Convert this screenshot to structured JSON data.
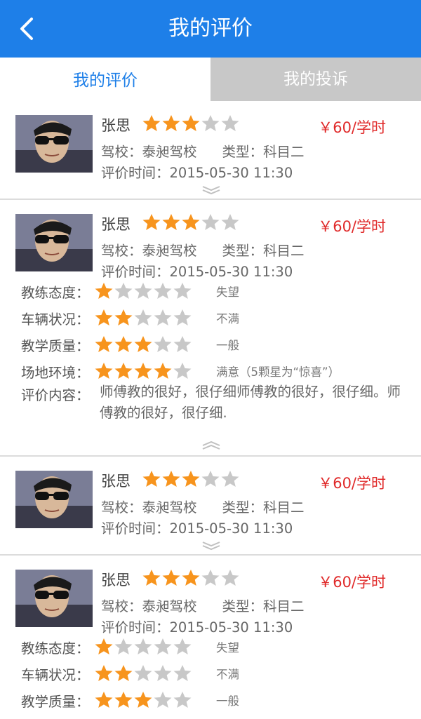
{
  "header": {
    "title": "我的评价",
    "back_icon": "chevron-left-icon",
    "bg_color": "#1e7fe8"
  },
  "tabs": [
    {
      "label": "我的评价",
      "active": true
    },
    {
      "label": "我的投诉",
      "active": false
    }
  ],
  "colors": {
    "star_on": "#f7941d",
    "star_off": "#c8c8c8",
    "price": "#e02a2a"
  },
  "reviews": [
    {
      "name": "张思",
      "stars": 3,
      "price": "￥60/学时",
      "school_label": "驾校：",
      "school": "泰昶驾校",
      "type_label": "类型：",
      "type": "科目二",
      "time_label": "评价时间：",
      "time": "2015-05-30  11:30",
      "expanded": false,
      "toggle_icon": "chevron-down-double-icon"
    },
    {
      "name": "张思",
      "stars": 3,
      "price": "￥60/学时",
      "school_label": "驾校：",
      "school": "泰昶驾校",
      "type_label": "类型：",
      "type": "科目二",
      "time_label": "评价时间：",
      "time": "2015-05-30  11:30",
      "expanded": true,
      "toggle_icon": "chevron-up-double-icon",
      "ratings": [
        {
          "label": "教练态度：",
          "stars": 1,
          "desc": "失望"
        },
        {
          "label": "车辆状况：",
          "stars": 2,
          "desc": "不满"
        },
        {
          "label": "教学质量：",
          "stars": 3,
          "desc": "一般"
        },
        {
          "label": "场地环境：",
          "stars": 4,
          "desc": "满意（5颗星为“惊喜”）"
        }
      ],
      "comment_label": "评价内容：",
      "comment": "师傅教的很好，很仔细师傅教的很好，很仔细。师傅教的很好，很仔细."
    },
    {
      "name": "张思",
      "stars": 3,
      "price": "￥60/学时",
      "school_label": "驾校：",
      "school": "泰昶驾校",
      "type_label": "类型：",
      "type": "科目二",
      "time_label": "评价时间：",
      "time": "2015-05-30  11:30",
      "expanded": false,
      "toggle_icon": "chevron-down-double-icon"
    },
    {
      "name": "张思",
      "stars": 3,
      "price": "￥60/学时",
      "school_label": "驾校：",
      "school": "泰昶驾校",
      "type_label": "类型：",
      "type": "科目二",
      "time_label": "评价时间：",
      "time": "2015-05-30  11:30",
      "expanded": true,
      "ratings": [
        {
          "label": "教练态度：",
          "stars": 1,
          "desc": "失望"
        },
        {
          "label": "车辆状况：",
          "stars": 2,
          "desc": "不满"
        },
        {
          "label": "教学质量：",
          "stars": 3,
          "desc": "一般"
        }
      ]
    }
  ]
}
